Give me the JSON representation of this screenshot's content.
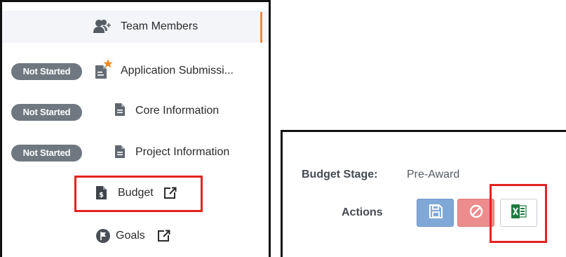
{
  "nav": {
    "items": [
      {
        "label": "Team Members",
        "icon": "team-members-icon",
        "active": true
      },
      {
        "label": "Application Submissi...",
        "icon": "application-star-icon",
        "status": "Not Started"
      },
      {
        "label": "Core Information",
        "icon": "document-icon",
        "status": "Not Started"
      },
      {
        "label": "Project Information",
        "icon": "document-icon",
        "status": "Not Started"
      },
      {
        "label": "Budget",
        "icon": "budget-document-icon",
        "external": true
      },
      {
        "label": "Goals",
        "icon": "goals-flag-icon",
        "external": true
      }
    ]
  },
  "budget_panel": {
    "stage_label": "Budget Stage:",
    "stage_value": "Pre-Award",
    "actions_label": "Actions",
    "buttons": [
      {
        "name": "save",
        "icon": "save-icon"
      },
      {
        "name": "cancel",
        "icon": "ban-icon"
      },
      {
        "name": "export-excel",
        "icon": "excel-icon"
      }
    ]
  },
  "colors": {
    "active_indicator": "#ef8a3a",
    "status_badge": "#6f7780",
    "highlight_border": "#e3231e",
    "save_button": "#7fa8d6",
    "cancel_button": "#ec8c8c",
    "excel_green": "#1d7a3e"
  }
}
